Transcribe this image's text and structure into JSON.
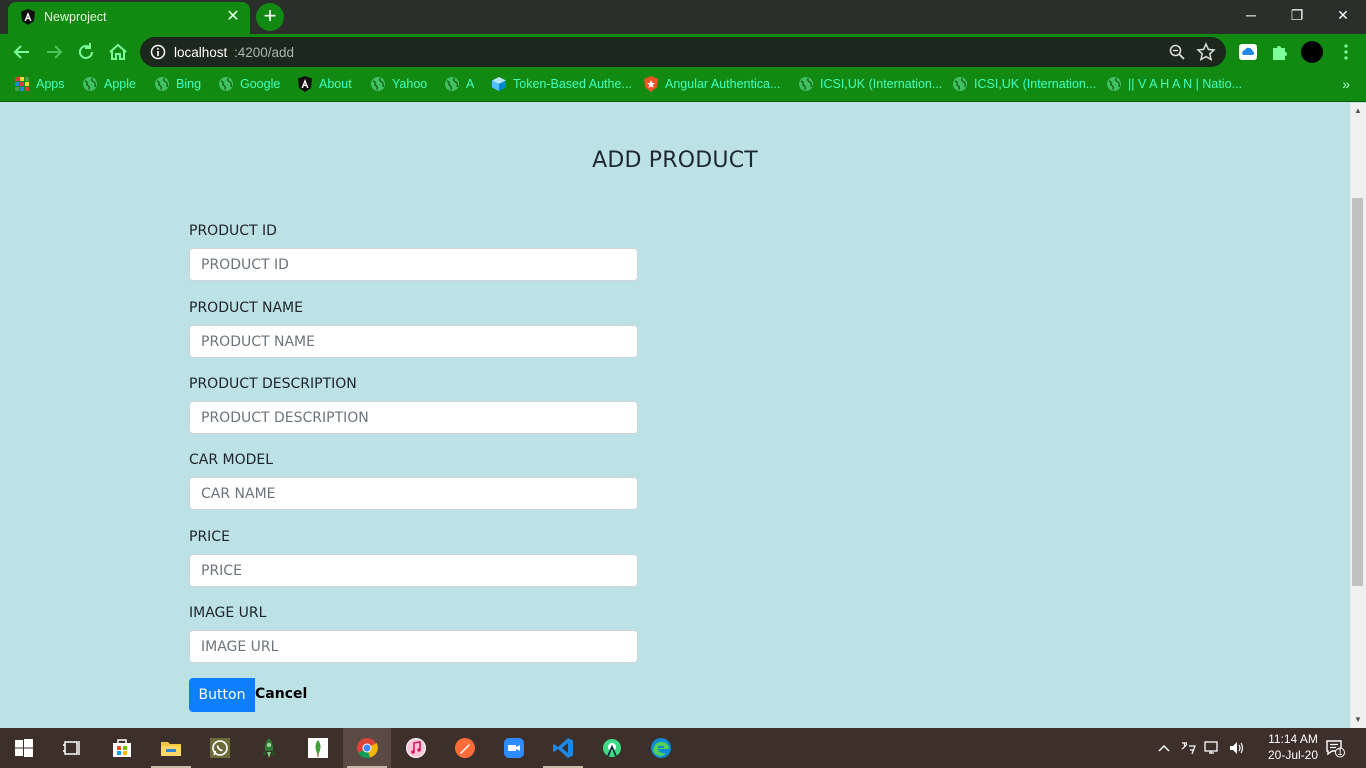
{
  "browser": {
    "tab_title": "Newproject",
    "new_tab": "+",
    "url_host": "localhost",
    "url_path": ":4200/add",
    "window_controls": {
      "minimize": "─",
      "restore": "❐",
      "close": "✕"
    },
    "tab_close": "✕",
    "bookmarks_more": "»"
  },
  "bookmarks": [
    {
      "label": "Apps",
      "icon": "apps-grid-icon"
    },
    {
      "label": "Apple",
      "icon": "globe-icon"
    },
    {
      "label": "Bing",
      "icon": "globe-icon"
    },
    {
      "label": "Google",
      "icon": "globe-icon"
    },
    {
      "label": "About",
      "icon": "angular-icon"
    },
    {
      "label": "Yahoo",
      "icon": "globe-icon"
    },
    {
      "label": "A",
      "icon": "globe-icon"
    },
    {
      "label": "Token-Based Authe...",
      "icon": "cube-icon"
    },
    {
      "label": "Angular Authentica...",
      "icon": "auth0-icon"
    },
    {
      "label": "ICSI,UK (Internation...",
      "icon": "globe-icon"
    },
    {
      "label": "ICSI,UK (Internation...",
      "icon": "globe-icon"
    },
    {
      "label": "|| V A H A N | Natio...",
      "icon": "globe-icon"
    }
  ],
  "page": {
    "title": "ADD PRODUCT",
    "fields": [
      {
        "label": "PRODUCT ID",
        "placeholder": "PRODUCT ID"
      },
      {
        "label": "PRODUCT NAME",
        "placeholder": "PRODUCT NAME"
      },
      {
        "label": "PRODUCT DESCRIPTION",
        "placeholder": "PRODUCT DESCRIPTION"
      },
      {
        "label": "CAR MODEL",
        "placeholder": "CAR NAME"
      },
      {
        "label": "PRICE",
        "placeholder": "PRICE"
      },
      {
        "label": "IMAGE URL",
        "placeholder": "IMAGE URL"
      }
    ],
    "submit_label": "Button",
    "cancel_label": "Cancel"
  },
  "taskbar": {
    "time": "11:14 AM",
    "date": "20-Jul-20",
    "notification_count": "1"
  },
  "colors": {
    "browser_green": "#128a12",
    "bookmark_text": "#40ffbf",
    "page_background": "#bce2e5",
    "primary_button": "#0d7efc",
    "taskbar": "#3d2f2a"
  }
}
